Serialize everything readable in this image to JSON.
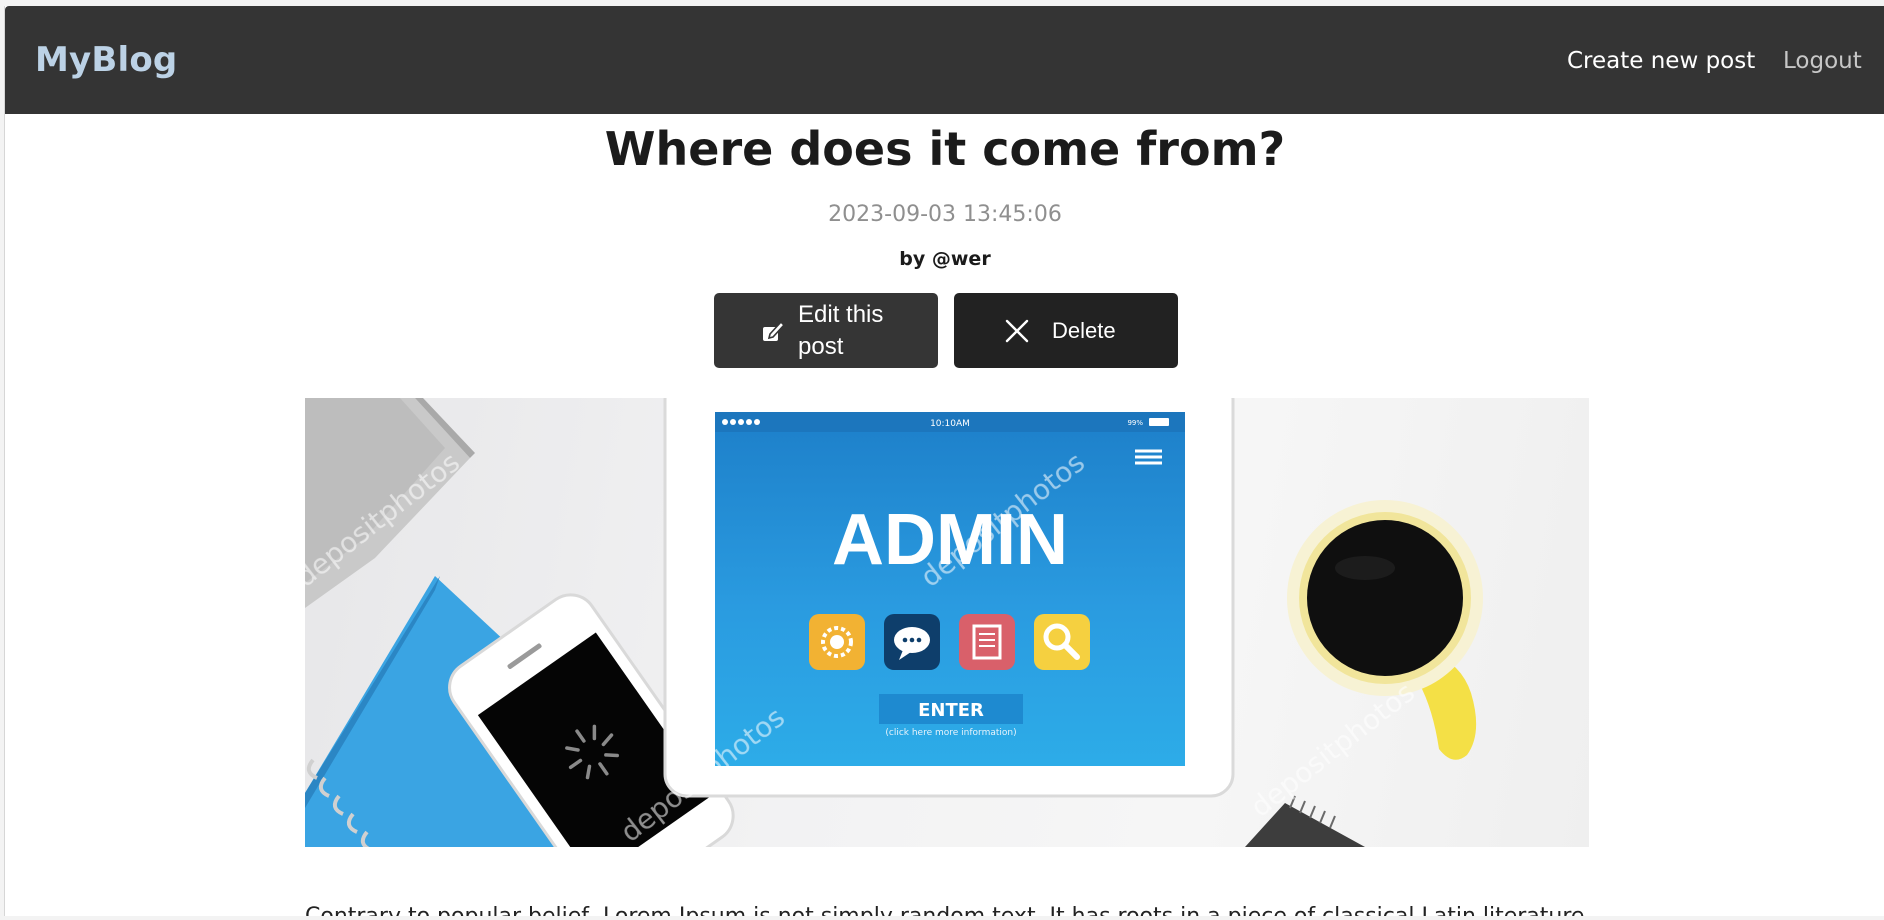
{
  "navbar": {
    "brand": "MyBlog",
    "links": [
      {
        "label": "Create new post"
      },
      {
        "label": "Logout"
      }
    ]
  },
  "post": {
    "title": "Where does it come from?",
    "date": "2023-09-03 13:45:06",
    "author": "by @wer",
    "body_visible": "Contrary to popular belief, Lorem Ipsum is not simply random text. It has roots in a piece of classical Latin literature from"
  },
  "actions": {
    "edit_label": "Edit this post",
    "edit_icon": "edit-icon",
    "delete_label": "Delete",
    "delete_icon": "close-icon"
  },
  "image": {
    "tablet_headline": "ADMIN",
    "tablet_button": "ENTER",
    "tablet_subtext": "(click here more information)",
    "tablet_time": "10:10AM",
    "tablet_battery": "99%",
    "watermark": "depositphotos",
    "colors": {
      "screen_blue": "#2a9be0",
      "app_yellow": "#f2b233",
      "app_navy": "#0e3e6b",
      "app_red": "#d9606a",
      "app_gold": "#f5d040",
      "notebook_blue": "#3aa4e3",
      "mug_yellow": "#f4e046"
    }
  }
}
